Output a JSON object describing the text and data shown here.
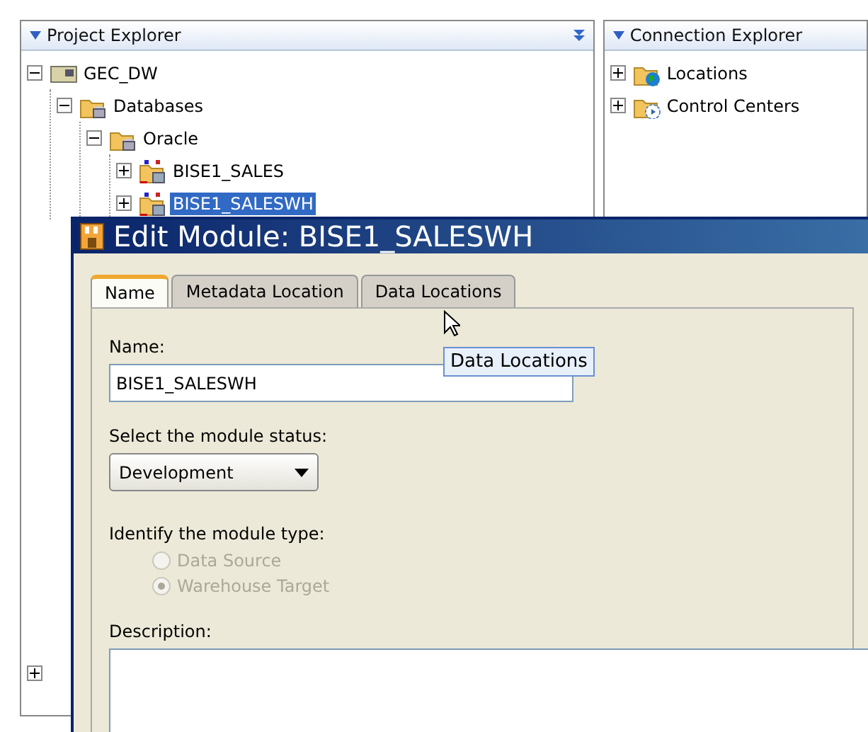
{
  "project_explorer": {
    "title": "Project Explorer",
    "tree": [
      {
        "label": "GEC_DW",
        "kind": "server",
        "expanded": true,
        "selected": false,
        "children": [
          {
            "label": "Databases",
            "kind": "folder-db",
            "expanded": true,
            "selected": false,
            "children": [
              {
                "label": "Oracle",
                "kind": "folder-db",
                "expanded": true,
                "selected": false,
                "children": [
                  {
                    "label": "BISE1_SALES",
                    "kind": "module",
                    "expanded": false,
                    "selected": false
                  },
                  {
                    "label": "BISE1_SALESWH",
                    "kind": "module",
                    "expanded": false,
                    "selected": true
                  }
                ]
              }
            ]
          }
        ]
      },
      {
        "expanded": false
      }
    ]
  },
  "connection_explorer": {
    "title": "Connection Explorer",
    "tree": [
      {
        "label": "Locations",
        "kind": "folder-globe",
        "expanded": false,
        "selected": false
      },
      {
        "label": "Control Centers",
        "kind": "folder-control",
        "expanded": false,
        "selected": false
      }
    ]
  },
  "dialog": {
    "title": "Edit Module: BISE1_SALESWH",
    "tabs": [
      {
        "label": "Name",
        "selected": true
      },
      {
        "label": "Metadata Location",
        "selected": false
      },
      {
        "label": "Data Locations",
        "selected": false
      }
    ],
    "tooltip": "Data Locations",
    "name_label": "Name:",
    "name_value": "BISE1_SALESWH",
    "status_label": "Select the module status:",
    "status_value": "Development",
    "type_label": "Identify the module type:",
    "types": [
      {
        "label": "Data Source",
        "selected": false,
        "disabled": true
      },
      {
        "label": "Warehouse Target",
        "selected": true,
        "disabled": true
      }
    ],
    "description_label": "Description:"
  }
}
